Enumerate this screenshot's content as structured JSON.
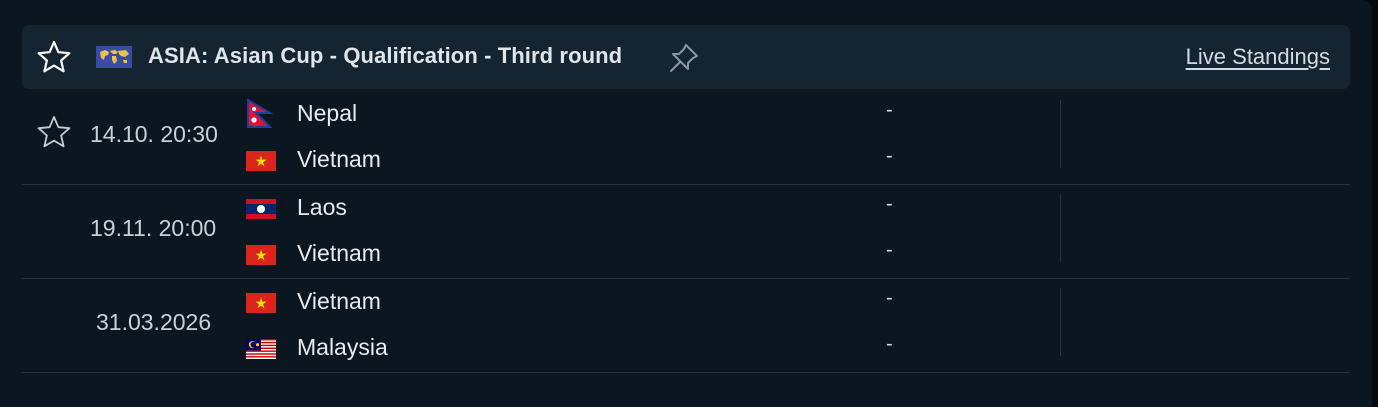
{
  "header": {
    "league_title": "ASIA: Asian Cup - Qualification - Third round",
    "live_standings_label": "Live Standings",
    "star_icon": "star-outline-icon",
    "pin_icon": "pin-icon",
    "flag_icon": "world-flag-icon"
  },
  "matches": [
    {
      "time": "14.10. 20:30",
      "home": {
        "name": "Nepal",
        "flag": "nepal-flag",
        "score": "-"
      },
      "away": {
        "name": "Vietnam",
        "flag": "vietnam-flag",
        "score": "-"
      },
      "has_star": true
    },
    {
      "time": "19.11. 20:00",
      "home": {
        "name": "Laos",
        "flag": "laos-flag",
        "score": "-"
      },
      "away": {
        "name": "Vietnam",
        "flag": "vietnam-flag",
        "score": "-"
      },
      "has_star": false
    },
    {
      "time": "31.03.2026",
      "home": {
        "name": "Vietnam",
        "flag": "vietnam-flag",
        "score": "-"
      },
      "away": {
        "name": "Malaysia",
        "flag": "malaysia-flag",
        "score": "-"
      },
      "has_star": false
    }
  ],
  "colors": {
    "background": "#050a10",
    "panel": "#0b1620",
    "header": "#142430",
    "text": "#e7ebee"
  }
}
